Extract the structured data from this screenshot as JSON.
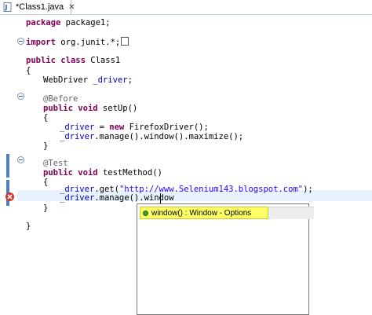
{
  "tab": {
    "label": "*Class1.java",
    "close_glyph": "✕",
    "icon": "java-file-icon"
  },
  "code": {
    "package_kw": "package",
    "package_rest": " package1;",
    "import_kw": "import",
    "import_rest": " org.junit.*;",
    "class_kw1": "public",
    "class_kw2": "class",
    "class_name": " Class1",
    "open_brace": "{",
    "field_type": "WebDriver ",
    "field_name": "_driver",
    "field_semi": ";",
    "before_ann": "@Before",
    "setup_kw1": "public",
    "setup_kw2": "void",
    "setup_rest": " setUp()",
    "driver": "_driver",
    "assign_eq": " = ",
    "new_kw": "new",
    "new_rest": " FirefoxDriver();",
    "maximize_rest": ".manage().window().maximize();",
    "close_brace": "}",
    "test_ann": "@Test",
    "test_kw1": "public",
    "test_kw2": "void",
    "test_rest": " testMethod()",
    "get_prefix": ".get(",
    "get_url": "\"http://www.Selenium143.blogspot.com\"",
    "get_suffix": ");",
    "window_rest": ".manage().window"
  },
  "assist": {
    "item_label": "window() : Window - Options",
    "item_icon": "public-method-icon"
  },
  "colors": {
    "keyword": "#7f0055",
    "field": "#0000c0",
    "string": "#2a00ff",
    "annotation": "#646464",
    "assist_highlight": "#ffff66"
  }
}
